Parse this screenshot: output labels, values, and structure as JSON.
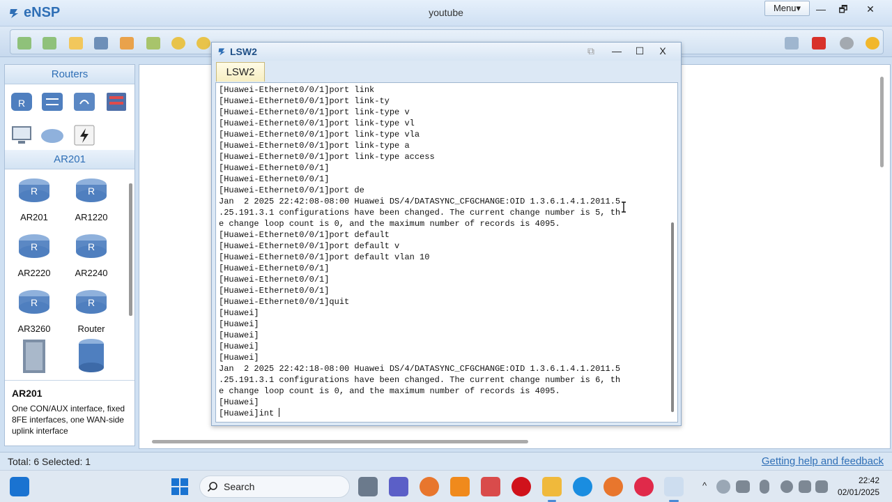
{
  "app": {
    "name": "eNSP",
    "window_title": "youtube",
    "menu_label": "Menu",
    "menu_arrow": "▾",
    "minimize": "—",
    "restore": "🗗",
    "close": "✕"
  },
  "left_panel": {
    "section_routers": "Routers",
    "section_ar201": "AR201",
    "devices": [
      {
        "label": "AR201"
      },
      {
        "label": "AR1220"
      },
      {
        "label": "AR2220"
      },
      {
        "label": "AR2240"
      },
      {
        "label": "AR3260"
      },
      {
        "label": "Router"
      }
    ],
    "description": {
      "title": "AR201",
      "text": "One CON/AUX interface, fixed 8FE interfaces, one WAN-side uplink interface"
    }
  },
  "cli_window": {
    "title": "LSW2",
    "tab": "LSW2",
    "minimize": "—",
    "maximize": "☐",
    "close": "X",
    "lines": [
      "[Huawei-Ethernet0/0/1]port link",
      "[Huawei-Ethernet0/0/1]port link-ty",
      "[Huawei-Ethernet0/0/1]port link-type v",
      "[Huawei-Ethernet0/0/1]port link-type vl",
      "[Huawei-Ethernet0/0/1]port link-type vla",
      "[Huawei-Ethernet0/0/1]port link-type a",
      "[Huawei-Ethernet0/0/1]port link-type access",
      "[Huawei-Ethernet0/0/1]",
      "[Huawei-Ethernet0/0/1]",
      "[Huawei-Ethernet0/0/1]port de",
      "Jan  2 2025 22:42:08-08:00 Huawei DS/4/DATASYNC_CFGCHANGE:OID 1.3.6.1.4.1.2011.5",
      ".25.191.3.1 configurations have been changed. The current change number is 5, th",
      "e change loop count is 0, and the maximum number of records is 4095.",
      "[Huawei-Ethernet0/0/1]port default",
      "[Huawei-Ethernet0/0/1]port default v",
      "[Huawei-Ethernet0/0/1]port default vlan 10",
      "[Huawei-Ethernet0/0/1]",
      "[Huawei-Ethernet0/0/1]",
      "[Huawei-Ethernet0/0/1]",
      "[Huawei-Ethernet0/0/1]quit",
      "[Huawei]",
      "[Huawei]",
      "[Huawei]",
      "[Huawei]",
      "[Huawei]",
      "Jan  2 2025 22:42:18-08:00 Huawei DS/4/DATASYNC_CFGCHANGE:OID 1.3.6.1.4.1.2011.5",
      ".25.191.3.1 configurations have been changed. The current change number is 6, th",
      "e change loop count is 0, and the maximum number of records is 4095.",
      "[Huawei]"
    ],
    "input_line": "[Huawei]int "
  },
  "status_bar": {
    "left": "Total: 6  Selected: 1",
    "right": "Getting help and feedback"
  },
  "taskbar": {
    "search_label": "Search",
    "time": "22:42",
    "date": "02/01/2025"
  },
  "colors": {
    "accent": "#2f6fb6",
    "titlebar": "#d7e5f4",
    "cli_tab": "#f7eec2"
  }
}
